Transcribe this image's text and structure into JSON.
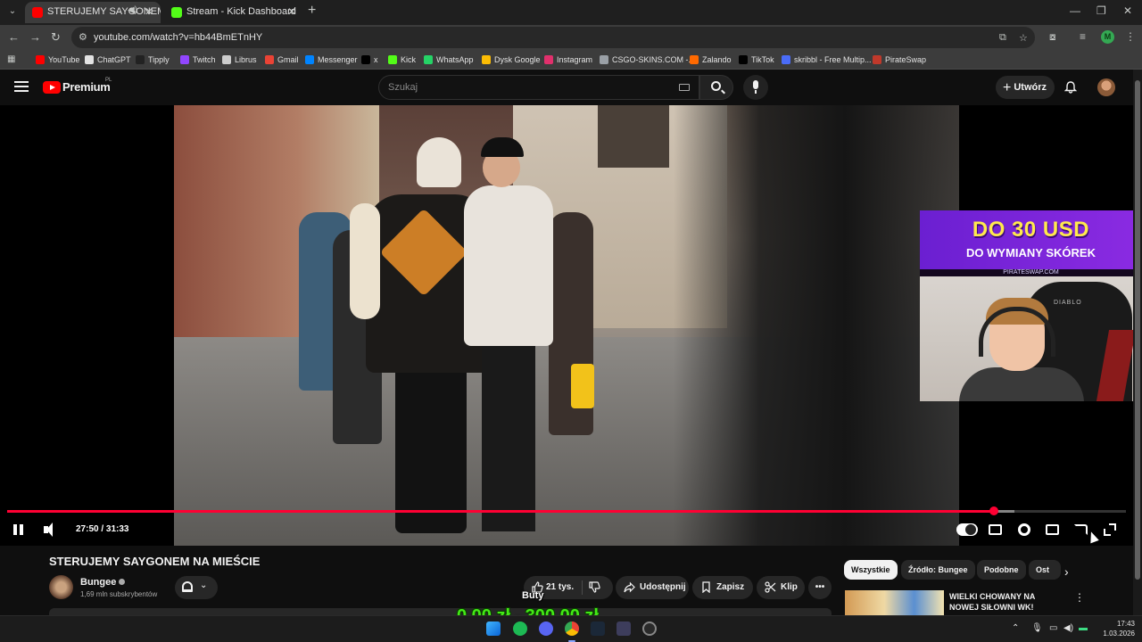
{
  "browser": {
    "tabs": [
      {
        "title": "STERUJEMY SAYGONEM NA",
        "active": true,
        "color": "#ff0000"
      },
      {
        "title": "Stream - Kick Dashboard",
        "active": false,
        "color": "#53fc18"
      }
    ],
    "url": "youtube.com/watch?v=hb44BmETnHY",
    "profile_initial": "M",
    "bookmarks": [
      {
        "label": "YouTube",
        "color": "#ff0000"
      },
      {
        "label": "ChatGPT",
        "color": "#e3e3e3"
      },
      {
        "label": "Tipply",
        "color": "#222222"
      },
      {
        "label": "Twitch",
        "color": "#9146ff"
      },
      {
        "label": "Librus",
        "color": "#cccccc"
      },
      {
        "label": "Gmail",
        "color": "#ea4335"
      },
      {
        "label": "Messenger",
        "color": "#0084ff"
      },
      {
        "label": "x",
        "color": "#000000"
      },
      {
        "label": "Kick",
        "color": "#53fc18"
      },
      {
        "label": "WhatsApp",
        "color": "#25d366"
      },
      {
        "label": "Dysk Google",
        "color": "#fbbc04"
      },
      {
        "label": "Instagram",
        "color": "#e1306c"
      },
      {
        "label": "CSGO-SKINS.COM -...",
        "color": "#9aa0a6"
      },
      {
        "label": "Zalando",
        "color": "#ff6900"
      },
      {
        "label": "TikTok",
        "color": "#000000"
      },
      {
        "label": "skribbl - Free Multip...",
        "color": "#4a6cf7"
      },
      {
        "label": "PirateSwap",
        "color": "#c0392b"
      }
    ]
  },
  "youtube": {
    "logo_text": "Premium",
    "country_code": "PL",
    "search_placeholder": "Szukaj",
    "create_label": "Utwórz"
  },
  "player": {
    "current_time": "27:50",
    "duration": "31:33",
    "time_text": "27:50 / 31:33",
    "progress_fraction": 0.882,
    "buffer_fraction": 0.9,
    "progress_color": "#ff0033"
  },
  "overlay": {
    "ad_line1": "DO 30 USD",
    "ad_line2": "DO WYMIANY SKÓREK",
    "ad_url": "PIRATESWAP.COM",
    "chair_brand": "DIABLO",
    "label": "Buty",
    "money_current": "0,00 zł",
    "money_separator": "z",
    "money_goal": "300,00 zł"
  },
  "video": {
    "title": "STERUJEMY SAYGONEM NA MIEŚCIE",
    "channel": "Bungee",
    "subscribers": "1,69 mln subskrybentów",
    "likes": "21 tys.",
    "share_label": "Udostępnij",
    "save_label": "Zapisz",
    "clip_label": "Klip",
    "more_label": "•••"
  },
  "sidebar": {
    "chips": [
      {
        "label": "Wszystkie",
        "active": true
      },
      {
        "label": "Źródło: Bungee",
        "active": false
      },
      {
        "label": "Podobne",
        "active": false
      },
      {
        "label": "Ost",
        "active": false
      }
    ],
    "recommended": [
      {
        "title": "WIELKI CHOWANY NA NOWEJ SIŁOWNI WK!"
      }
    ]
  },
  "taskbar": {
    "time": "17:43",
    "date": "1.03.2026"
  }
}
